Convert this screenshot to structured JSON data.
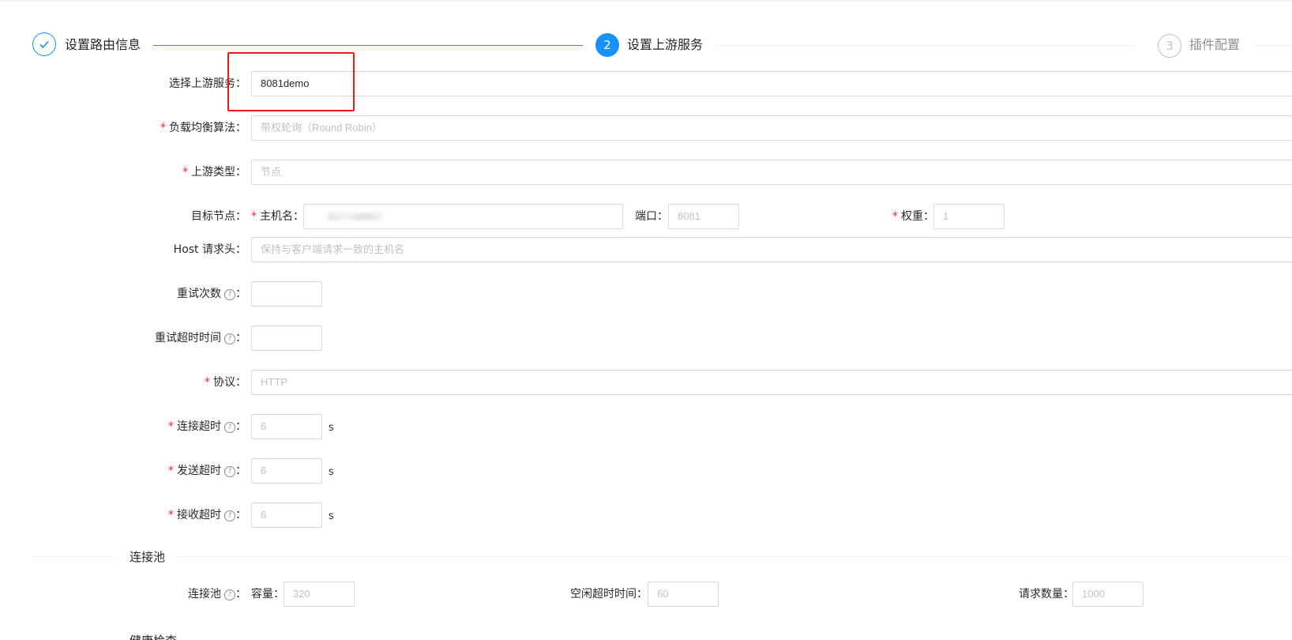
{
  "steps": [
    {
      "title": "设置路由信息",
      "status": "finish"
    },
    {
      "number": "2",
      "title": "设置上游服务",
      "status": "process"
    },
    {
      "number": "3",
      "title": "插件配置",
      "status": "wait"
    }
  ],
  "form": {
    "upstream_select": {
      "label": "选择上游服务：",
      "value": "8081demo"
    },
    "lb_algorithm": {
      "label": "负载均衡算法：",
      "value": "带权轮询（Round Robin）"
    },
    "upstream_type": {
      "label": "上游类型：",
      "value": "节点"
    },
    "target_node": {
      "label": "目标节点：",
      "host_label": "主机名：",
      "port_label": "端口：",
      "port_value": "8081",
      "weight_label": "权重：",
      "weight_value": "1"
    },
    "host_header": {
      "label": "Host 请求头：",
      "placeholder": "保持与客户端请求一致的主机名"
    },
    "retries": {
      "label": "重试次数"
    },
    "retry_timeout": {
      "label": "重试超时时间"
    },
    "protocol": {
      "label": "协议：",
      "value": "HTTP"
    },
    "connect_timeout": {
      "label": "连接超时",
      "value": "6",
      "unit": "s"
    },
    "send_timeout": {
      "label": "发送超时",
      "value": "6",
      "unit": "s"
    },
    "read_timeout": {
      "label": "接收超时",
      "value": "6",
      "unit": "s"
    },
    "colon": "：",
    "help_glyph": "?"
  },
  "keepalive": {
    "section_title": "连接池",
    "label": "连接池",
    "size_label": "容量：",
    "size_value": "320",
    "idle_label": "空闲超时时间：",
    "idle_value": "60",
    "requests_label": "请求数量：",
    "requests_value": "1000"
  },
  "health_check": {
    "section_title": "健康检查"
  },
  "colors": {
    "primary": "#1890ff",
    "required": "#f5222d",
    "highlight": "#e31b1b"
  }
}
